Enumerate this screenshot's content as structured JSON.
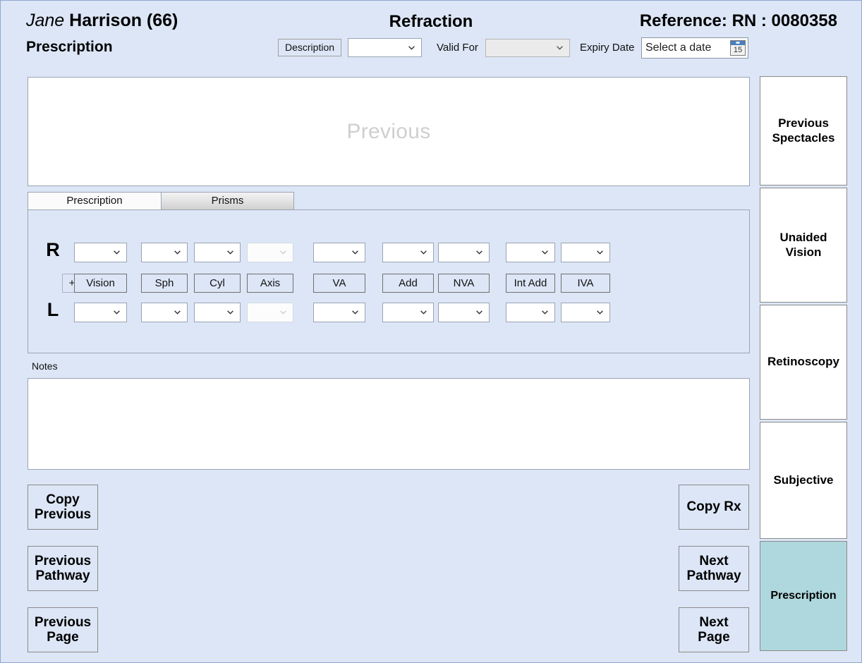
{
  "header": {
    "patient_given_name": "Jane",
    "patient_family_name": "Harrison (66)",
    "page_title": "Refraction",
    "reference": "Reference: RN : 0080358"
  },
  "subheader": {
    "section_title": "Prescription",
    "description_button": "Description",
    "description_select_value": "",
    "valid_for_label": "Valid For",
    "valid_for_value": "",
    "expiry_date_label": "Expiry Date",
    "expiry_date_value": "Select a date",
    "calendar_icon_day": "15"
  },
  "previous_panel": {
    "watermark": "Previous"
  },
  "tabs": [
    {
      "label": "Prescription",
      "active": true
    },
    {
      "label": "Prisms",
      "active": false
    }
  ],
  "prescription_grid": {
    "right_eye_label": "R",
    "left_eye_label": "L",
    "sign_toggle_label": "+/−",
    "columns": [
      {
        "label": "Vision",
        "right_value": "",
        "left_value": "",
        "disabled": false
      },
      {
        "label": "Sph",
        "right_value": "",
        "left_value": "",
        "disabled": false
      },
      {
        "label": "Cyl",
        "right_value": "",
        "left_value": "",
        "disabled": false
      },
      {
        "label": "Axis",
        "right_value": "",
        "left_value": "",
        "disabled": true
      },
      {
        "label": "VA",
        "right_value": "",
        "left_value": "",
        "disabled": false
      },
      {
        "label": "Add",
        "right_value": "",
        "left_value": "",
        "disabled": false
      },
      {
        "label": "NVA",
        "right_value": "",
        "left_value": "",
        "disabled": false
      },
      {
        "label": "Int Add",
        "right_value": "",
        "left_value": "",
        "disabled": false
      },
      {
        "label": "IVA",
        "right_value": "",
        "left_value": "",
        "disabled": false
      }
    ]
  },
  "notes": {
    "label": "Notes",
    "value": ""
  },
  "nav_buttons": {
    "copy_previous": "Copy\nPrevious",
    "previous_pathway": "Previous\nPathway",
    "previous_page": "Previous\nPage",
    "copy_rx": "Copy Rx",
    "next_pathway": "Next\nPathway",
    "next_page": "Next\nPage"
  },
  "sidebar": {
    "items": [
      {
        "label": "Previous\nSpectacles",
        "active": false
      },
      {
        "label": "Unaided\nVision",
        "active": false
      },
      {
        "label": "Retinoscopy",
        "active": false
      },
      {
        "label": "Subjective",
        "active": false
      },
      {
        "label": "Prescription",
        "active": true
      }
    ]
  },
  "colors": {
    "page_background": "#dce6f6",
    "panel_white": "#ffffff",
    "accent_active": "#aed8de",
    "border_grey": "#8a8a8a",
    "watermark_grey": "#cfcfcf",
    "calendar_header_blue": "#4a7fbd"
  }
}
